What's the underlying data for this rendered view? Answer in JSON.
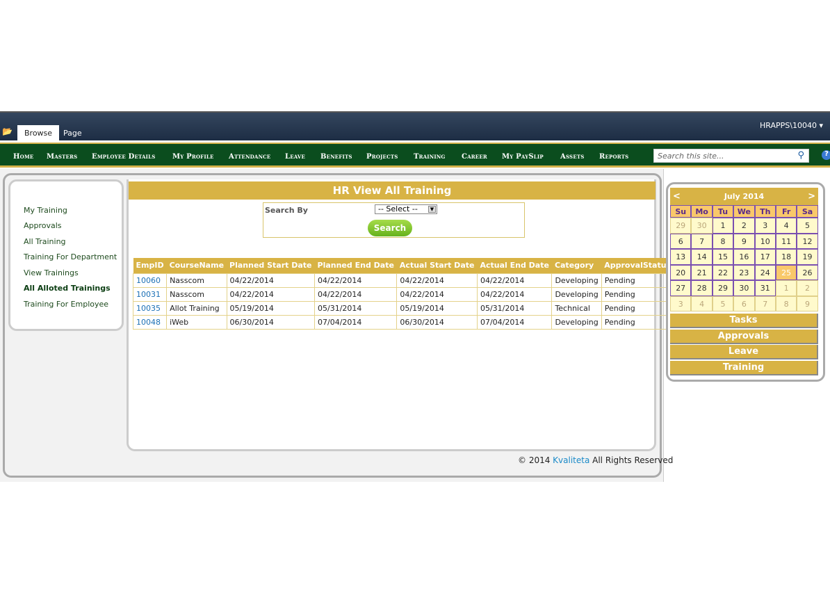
{
  "ribbon": {
    "tabs": [
      "Browse",
      "Page"
    ],
    "user": "HRAPPS\\10040 ▾"
  },
  "nav": {
    "items": [
      "Home",
      "Masters",
      "Employee Details",
      "My Profile",
      "Attendance",
      "Leave",
      "Benefits",
      "Projects",
      "Training",
      "Career",
      "My PaySlip",
      "Assets",
      "Reports"
    ],
    "search_placeholder": "Search this site..."
  },
  "sidebar": {
    "items": [
      "My Training",
      "Approvals",
      "All Training",
      "Training For Department",
      "View Trainings",
      "All Alloted Trainings",
      "Training For Employee"
    ],
    "active": "All Alloted Trainings"
  },
  "main": {
    "title": "HR View All Training",
    "search_by_label": "Search By",
    "select_value": "-- Select --",
    "search_button": "Search",
    "columns": [
      "EmpID",
      "CourseName",
      "Planned Start Date",
      "Planned End Date",
      "Actual Start Date",
      "Actual End Date",
      "Category",
      "ApprovalStatus"
    ],
    "rows": [
      [
        "10060",
        "Nasscom",
        "04/22/2014",
        "04/22/2014",
        "04/22/2014",
        "04/22/2014",
        "Developing",
        "Pending"
      ],
      [
        "10031",
        "Nasscom",
        "04/22/2014",
        "04/22/2014",
        "04/22/2014",
        "04/22/2014",
        "Developing",
        "Pending"
      ],
      [
        "10035",
        "Allot Training",
        "05/19/2014",
        "05/31/2014",
        "05/19/2014",
        "05/31/2014",
        "Technical",
        "Pending"
      ],
      [
        "10048",
        "iWeb",
        "06/30/2014",
        "07/04/2014",
        "06/30/2014",
        "07/04/2014",
        "Developing",
        "Pending"
      ]
    ]
  },
  "footer": {
    "prefix": "© 2014 ",
    "brand": "Kvaliteta",
    "suffix": " All Rights Reserved"
  },
  "calendar": {
    "month": "July 2014",
    "prev": "<",
    "next": ">",
    "days_of_week": [
      "Su",
      "Mo",
      "Tu",
      "We",
      "Th",
      "Fr",
      "Sa"
    ],
    "days": [
      "29",
      "30",
      "1",
      "2",
      "3",
      "4",
      "5",
      "6",
      "7",
      "8",
      "9",
      "10",
      "11",
      "12",
      "13",
      "14",
      "15",
      "16",
      "17",
      "18",
      "19",
      "20",
      "21",
      "22",
      "23",
      "24",
      "25",
      "26",
      "27",
      "28",
      "29",
      "30",
      "31",
      "1",
      "2",
      "3",
      "4",
      "5",
      "6",
      "7",
      "8",
      "9"
    ],
    "today": "25"
  },
  "right_buttons": [
    "Tasks",
    "Approvals",
    "Leave",
    "Training"
  ],
  "colors": {
    "gold": "#d8b345",
    "nav_green": "#0b4d1e",
    "ribbon": "#1d2d44"
  }
}
